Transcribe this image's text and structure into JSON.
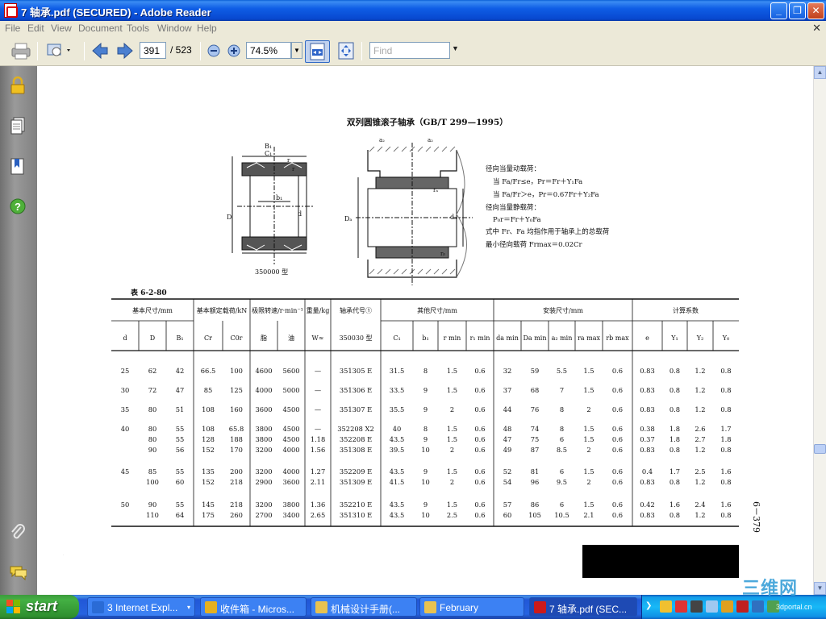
{
  "window": {
    "title": "7  轴承.pdf (SECURED) - Adobe Reader"
  },
  "menu": [
    "File",
    "Edit",
    "View",
    "Document",
    "Tools",
    "Window",
    "Help"
  ],
  "toolbar": {
    "page_current": "391",
    "page_total": "/  523",
    "zoom": "74.5%",
    "find_placeholder": "Find"
  },
  "document": {
    "heading": "双列圆锥滚子轴承（GB/T 299—1995）",
    "fig1_caption": "350000 型",
    "fig1_labels": [
      "B₁",
      "C₁",
      "r",
      "r",
      "b₁",
      "D",
      "d"
    ],
    "fig2_labels": [
      "a₂",
      "a₂",
      "rₐ",
      "rᵦ",
      "Dₐ",
      "dₐ"
    ],
    "formulas": [
      "径向当量动载荷：",
      "当 Fa/Fr≤e，Pr＝Fr＋Y₁Fa",
      "当 Fa/Fr＞e，Pr＝0.67Fr＋Y₂Fa",
      "径向当量静载荷：",
      "P₀r＝Fr＋Y₀Fa",
      "式中   Fr、Fa 均指作用于轴承上的总载荷",
      "最小径向载荷 Frmax＝0.02Cr"
    ],
    "table_id": "表 6-2-80",
    "group_headers": [
      "基本尺寸/mm",
      "基本额定载荷/kN",
      "极限转速/r·min⁻¹",
      "重量/kg",
      "轴承代号①",
      "其他尺寸/mm",
      "安装尺寸/mm",
      "计算系数"
    ],
    "sub_headers": [
      "d",
      "D",
      "B₁",
      "Cr",
      "C0r",
      "脂",
      "油",
      "W≈",
      "350030 型",
      "C₁",
      "b₁",
      "r min",
      "r₁ min",
      "da min",
      "Da min",
      "a₂ min",
      "ra max",
      "rb max",
      "e",
      "Y₁",
      "Y₂",
      "Y₀"
    ],
    "rows": [
      [
        "25",
        "62",
        "42",
        "66.5",
        "100",
        "4600",
        "5600",
        "—",
        "351305 E",
        "31.5",
        "8",
        "1.5",
        "0.6",
        "32",
        "59",
        "5.5",
        "1.5",
        "0.6",
        "0.83",
        "0.8",
        "1.2",
        "0.8"
      ],
      [
        "30",
        "72",
        "47",
        "85",
        "125",
        "4000",
        "5000",
        "—",
        "351306 E",
        "33.5",
        "9",
        "1.5",
        "0.6",
        "37",
        "68",
        "7",
        "1.5",
        "0.6",
        "0.83",
        "0.8",
        "1.2",
        "0.8"
      ],
      [
        "35",
        "80",
        "51",
        "108",
        "160",
        "3600",
        "4500",
        "—",
        "351307 E",
        "35.5",
        "9",
        "2",
        "0.6",
        "44",
        "76",
        "8",
        "2",
        "0.6",
        "0.83",
        "0.8",
        "1.2",
        "0.8"
      ],
      [
        "40",
        "80",
        "55",
        "108",
        "65.8",
        "3800",
        "4500",
        "—",
        "352208 X2",
        "40",
        "8",
        "1.5",
        "0.6",
        "48",
        "74",
        "8",
        "1.5",
        "0.6",
        "0.38",
        "1.8",
        "2.6",
        "1.7"
      ],
      [
        "",
        "80",
        "55",
        "128",
        "188",
        "3800",
        "4500",
        "1.18",
        "352208 E",
        "43.5",
        "9",
        "1.5",
        "0.6",
        "47",
        "75",
        "6",
        "1.5",
        "0.6",
        "0.37",
        "1.8",
        "2.7",
        "1.8"
      ],
      [
        "",
        "90",
        "56",
        "152",
        "170",
        "3200",
        "4000",
        "1.56",
        "351308 E",
        "39.5",
        "10",
        "2",
        "0.6",
        "49",
        "87",
        "8.5",
        "2",
        "0.6",
        "0.83",
        "0.8",
        "1.2",
        "0.8"
      ],
      [
        "45",
        "85",
        "55",
        "135",
        "200",
        "3200",
        "4000",
        "1.27",
        "352209 E",
        "43.5",
        "9",
        "1.5",
        "0.6",
        "52",
        "81",
        "6",
        "1.5",
        "0.6",
        "0.4",
        "1.7",
        "2.5",
        "1.6"
      ],
      [
        "",
        "100",
        "60",
        "152",
        "218",
        "2900",
        "3600",
        "2.11",
        "351309 E",
        "41.5",
        "10",
        "2",
        "0.6",
        "54",
        "96",
        "9.5",
        "2",
        "0.6",
        "0.83",
        "0.8",
        "1.2",
        "0.8"
      ],
      [
        "50",
        "90",
        "55",
        "145",
        "218",
        "3200",
        "3800",
        "1.36",
        "352210 E",
        "43.5",
        "9",
        "1.5",
        "0.6",
        "57",
        "86",
        "6",
        "1.5",
        "0.6",
        "0.42",
        "1.6",
        "2.4",
        "1.6"
      ],
      [
        "",
        "110",
        "64",
        "175",
        "260",
        "2700",
        "3400",
        "2.65",
        "351310 E",
        "43.5",
        "10",
        "2.5",
        "0.6",
        "60",
        "105",
        "10.5",
        "2.1",
        "0.6",
        "0.83",
        "0.8",
        "1.2",
        "0.8"
      ]
    ],
    "page_number": "6－379"
  },
  "taskbar": {
    "start": "start",
    "tasks": [
      {
        "label": "3 Internet Expl...",
        "icon": "ie-icon",
        "color": "#2a6bd6",
        "arrow": "▾"
      },
      {
        "label": "收件箱 - Micros...",
        "icon": "outlook-icon",
        "color": "#e5b020",
        "arrow": ""
      },
      {
        "label": "机械设计手册(...",
        "icon": "folder-icon",
        "color": "#e8c250",
        "arrow": ""
      },
      {
        "label": "February",
        "icon": "folder-icon",
        "color": "#e8c250",
        "arrow": ""
      },
      {
        "label": "7  轴承.pdf (SEC...",
        "icon": "pdf-icon",
        "color": "#cc1a1a",
        "arrow": ""
      }
    ]
  },
  "watermark": {
    "text": "三维网",
    "sub": "3dportal.cn"
  }
}
